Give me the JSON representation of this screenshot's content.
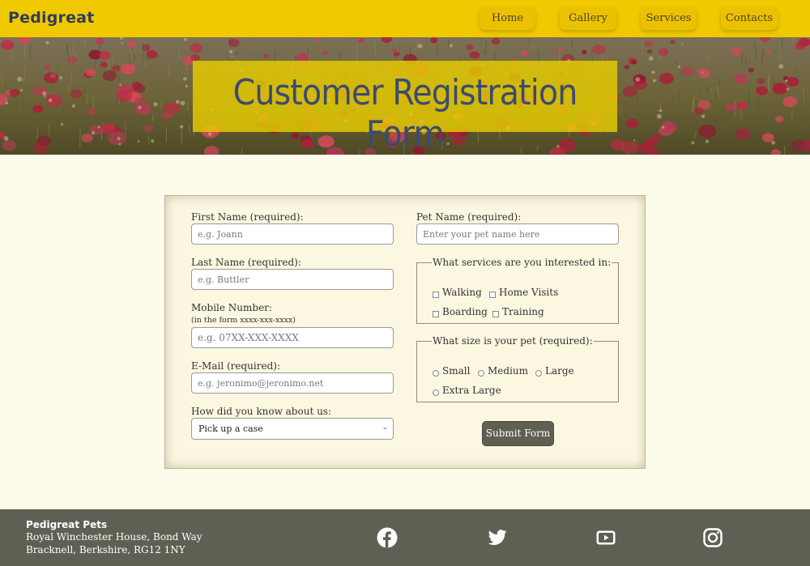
{
  "nav": {
    "brand": "Pedigreat",
    "links": [
      {
        "label": "Home"
      },
      {
        "label": "Gallery"
      },
      {
        "label": "Services"
      },
      {
        "label": "Contacts"
      }
    ]
  },
  "hero": {
    "title": "Customer Registration Form"
  },
  "form": {
    "first_name": {
      "label": "First Name (required):",
      "placeholder": "e.g. Joann"
    },
    "last_name": {
      "label": "Last Name (required):",
      "placeholder": "e.g. Buttler"
    },
    "mobile": {
      "label": "Mobile Number:",
      "hint": "(in the form xxxx-xxx-xxxx)",
      "placeholder": "e.g. 07XX-XXX-XXXX"
    },
    "email": {
      "label": "E-Mail (required):",
      "placeholder": "e.g. jeronimo@jeronimo.net"
    },
    "referral": {
      "label": "How did you know about us:",
      "selected": "Pick up a case"
    },
    "pet_name": {
      "label": "Pet Name (required):",
      "placeholder": "Enter your pet name here"
    },
    "services": {
      "legend": "What services are you interested in:",
      "options": [
        "Walking",
        "Home Visits",
        "Boarding",
        "Training"
      ]
    },
    "size": {
      "legend": "What size is your pet (required):",
      "options": [
        "Small",
        "Medium",
        "Large",
        "Extra Large"
      ]
    },
    "submit_label": "Submit Form"
  },
  "footer": {
    "company": "Pedigreat Pets",
    "address_line1": "Royal Winchester House, Bond Way",
    "address_line2": "Bracknell, Berkshire, RG12 1NY",
    "social": [
      "facebook-icon",
      "twitter-icon",
      "youtube-icon",
      "instagram-icon"
    ]
  },
  "colors": {
    "nav_bg": "#f1c900",
    "brand_text": "#2f3d5c",
    "page_bg": "#fdfbe9",
    "footer_bg": "#5f5f53",
    "button_bg": "#5f5f52"
  }
}
